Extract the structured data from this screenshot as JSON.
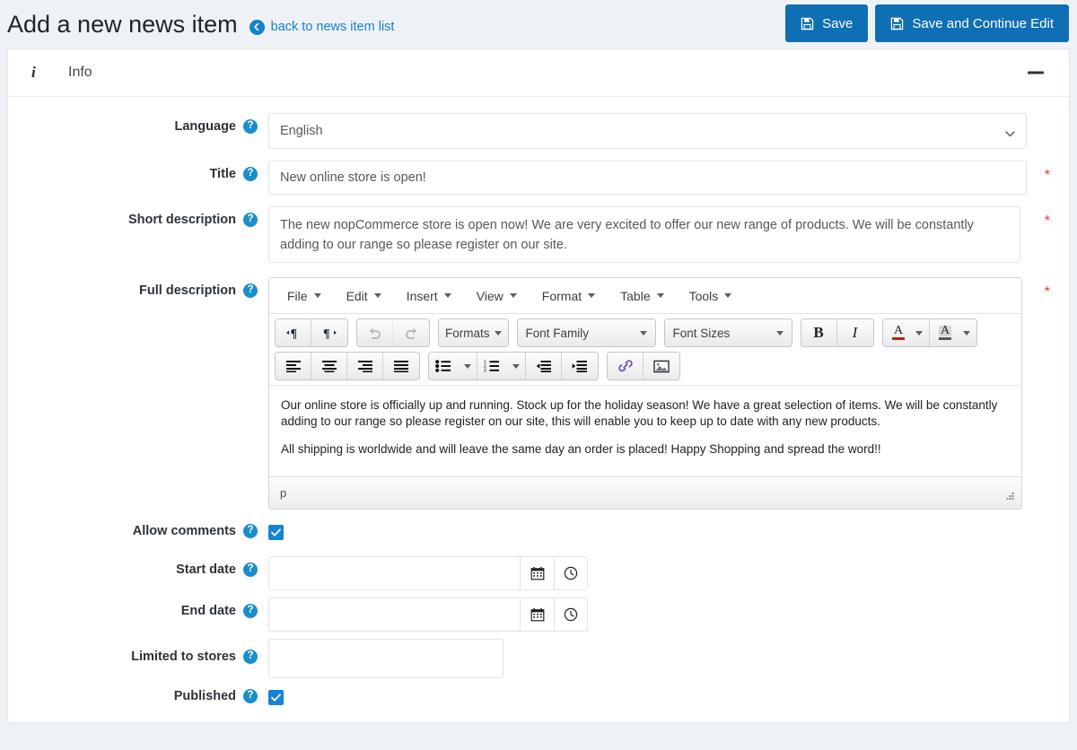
{
  "header": {
    "title": "Add a new news item",
    "back_link": "back to news item list",
    "back_icon": "arrow-left-circle-icon",
    "buttons": [
      {
        "label": "Save",
        "icon": "floppy-save-icon",
        "color": "#0f6fb5"
      },
      {
        "label": "Save and Continue Edit",
        "icon": "floppy-save-icon",
        "color": "#0f6fb5"
      }
    ]
  },
  "panel": {
    "icon": "info-icon",
    "title": "Info",
    "collapse_icon": "minus-icon"
  },
  "form": {
    "language": {
      "label": "Language",
      "help_icon": "question-circle-icon",
      "value": "English",
      "options": [
        "English"
      ],
      "required": false
    },
    "title": {
      "label": "Title",
      "help_icon": "question-circle-icon",
      "value": "New online store is open!",
      "placeholder": "",
      "required": true
    },
    "short_description": {
      "label": "Short description",
      "help_icon": "question-circle-icon",
      "value": "The new nopCommerce store is open now! We are very excited to offer our new range of products. We will be constantly adding to our range so please register on our site.",
      "required": true
    },
    "full_description": {
      "label": "Full description",
      "help_icon": "question-circle-icon",
      "required": true,
      "editor": {
        "menubar": [
          "File",
          "Edit",
          "Insert",
          "View",
          "Format",
          "Table",
          "Tools"
        ],
        "toolbar_row1": [
          {
            "name": "ltr-icon",
            "type": "icon"
          },
          {
            "name": "rtl-icon",
            "type": "icon"
          },
          {
            "name": "undo-icon",
            "type": "icon",
            "disabled": true
          },
          {
            "name": "redo-icon",
            "type": "icon",
            "disabled": true
          },
          {
            "name": "formats-select",
            "type": "select",
            "label": "Formats"
          },
          {
            "name": "font-family-select",
            "type": "select",
            "label": "Font Family"
          },
          {
            "name": "font-sizes-select",
            "type": "select",
            "label": "Font Sizes"
          },
          {
            "name": "bold-icon",
            "type": "icon",
            "label": "B"
          },
          {
            "name": "italic-icon",
            "type": "icon",
            "label": "I"
          },
          {
            "name": "text-color-icon",
            "type": "split",
            "label": "A"
          },
          {
            "name": "background-color-icon",
            "type": "split",
            "label": "A"
          }
        ],
        "toolbar_row2": [
          {
            "name": "align-left-icon"
          },
          {
            "name": "align-center-icon"
          },
          {
            "name": "align-right-icon"
          },
          {
            "name": "align-justify-icon"
          },
          {
            "name": "bullet-list-icon"
          },
          {
            "name": "numbered-list-icon"
          },
          {
            "name": "outdent-icon"
          },
          {
            "name": "indent-icon"
          },
          {
            "name": "link-icon"
          },
          {
            "name": "image-icon"
          }
        ],
        "labels": {
          "formats": "Formats",
          "font_family": "Font Family",
          "font_sizes": "Font Sizes",
          "bold": "B",
          "italic": "I",
          "text_color": "A",
          "background_color": "A"
        },
        "content_paragraphs": [
          "Our online store is officially up and running. Stock up for the holiday season! We have a great selection of items. We will be constantly adding to our range so please register on our site, this will enable you to keep up to date with any new products.",
          "All shipping is worldwide and will leave the same day an order is placed! Happy Shopping and spread the word!!"
        ],
        "statusbar_path": "p",
        "resize_icon": "resize-grip-icon"
      }
    },
    "allow_comments": {
      "label": "Allow comments",
      "help_icon": "question-circle-icon",
      "checked": true
    },
    "start_date": {
      "label": "Start date",
      "help_icon": "question-circle-icon",
      "value": "",
      "calendar_icon": "calendar-icon",
      "clock_icon": "clock-icon"
    },
    "end_date": {
      "label": "End date",
      "help_icon": "question-circle-icon",
      "value": "",
      "calendar_icon": "calendar-icon",
      "clock_icon": "clock-icon"
    },
    "limited_to_stores": {
      "label": "Limited to stores",
      "help_icon": "question-circle-icon",
      "value": ""
    },
    "published": {
      "label": "Published",
      "help_icon": "question-circle-icon",
      "checked": true
    },
    "required_marker": "*"
  },
  "colors": {
    "accent": "#0f6fb5",
    "link": "#1583c7",
    "help": "#1a8ecd",
    "checkbox": "#1583d6",
    "required": "#f13232",
    "page_bg": "#eef2f7"
  }
}
